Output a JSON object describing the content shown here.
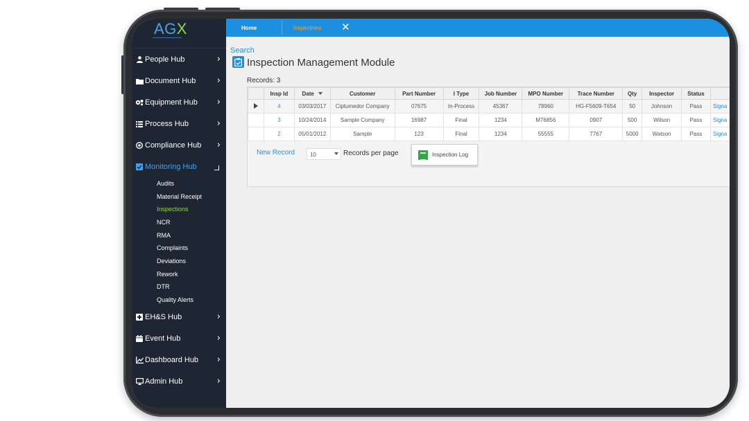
{
  "logo": {
    "ag": "AG",
    "x": "X"
  },
  "tabs": {
    "home": "Home",
    "inspections": "Inspections",
    "close": "✕"
  },
  "sidebar": {
    "items": [
      {
        "label": "People Hub",
        "icon": "user-icon"
      },
      {
        "label": "Document Hub",
        "icon": "folder-icon"
      },
      {
        "label": "Equipment Hub",
        "icon": "gears-icon"
      },
      {
        "label": "Process Hub",
        "icon": "list-icon"
      },
      {
        "label": "Compliance Hub",
        "icon": "target-icon"
      },
      {
        "label": "Monitoring Hub",
        "icon": "check-square-icon"
      },
      {
        "label": "EH&S Hub",
        "icon": "plus-square-icon"
      },
      {
        "label": "Event Hub",
        "icon": "calendar-icon"
      },
      {
        "label": "Dashboard Hub",
        "icon": "line-chart-icon"
      },
      {
        "label": "Admin Hub",
        "icon": "monitor-icon"
      }
    ],
    "monitoring_sub": [
      "Audits",
      "Material Receipt",
      "Inspections",
      "NCR",
      "RMA",
      "Complaints",
      "Deviations",
      "Rework",
      "DTR",
      "Quality Alerts"
    ],
    "active_sub": "Inspections"
  },
  "main": {
    "search": "Search",
    "title": "Inspection Management Module",
    "records": "Records:  3",
    "columns": [
      "Insp Id",
      "Date",
      "Customer",
      "Part Number",
      "I Type",
      "Job Number",
      "MPO Number",
      "Trace Number",
      "Qty",
      "Inspector",
      "Status"
    ],
    "rows": [
      [
        "4",
        "03/03/2017",
        "Ciptumedor Company",
        "07675",
        "In-Process",
        "45367",
        "78960",
        "HG-F5609-T654",
        "50",
        "Johnson",
        "Pass",
        "Signa"
      ],
      [
        "3",
        "10/24/2014",
        "Sample Company",
        "16987",
        "Final",
        "1234",
        "M76856",
        "0907",
        "500",
        "Wilson",
        "Pass",
        "Signa"
      ],
      [
        "2",
        "05/01/2012",
        "Sample",
        "123",
        "Final",
        "1234",
        "55555",
        "7767",
        "5000",
        "Watson",
        "Pass",
        "Signa"
      ]
    ],
    "new_record": "New Record",
    "per_page_value": "10",
    "per_page_label": "Records per page",
    "log_button": "Inspection Log"
  },
  "colors": {
    "sidebar": "#1e2533",
    "topbar": "#1d8fe1",
    "accent_green": "#8bd94a",
    "link": "#2b8fd8"
  }
}
